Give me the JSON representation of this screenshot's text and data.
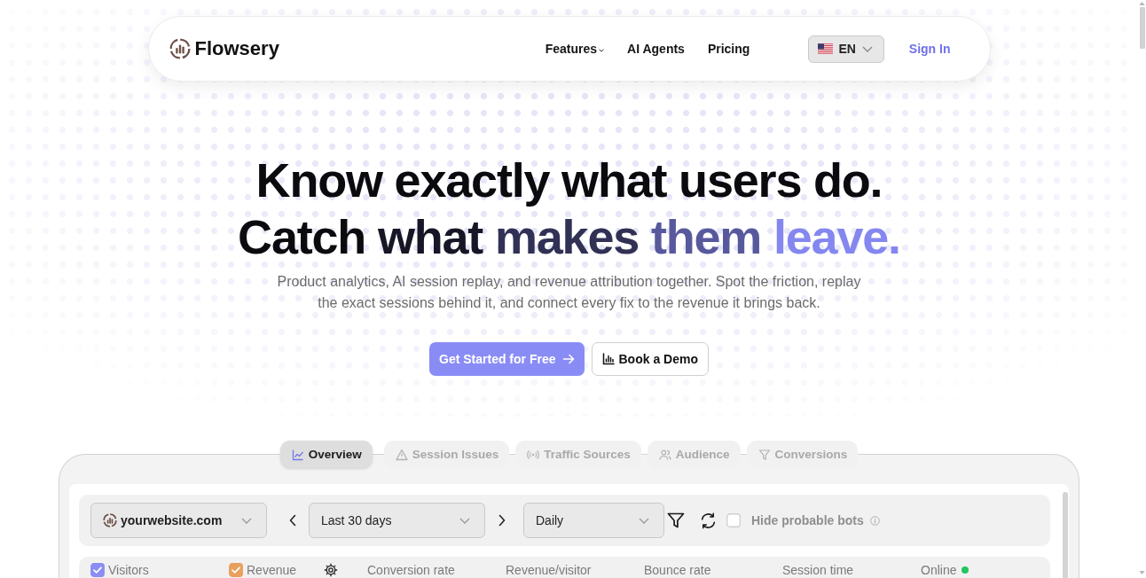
{
  "nav": {
    "brand": "Flowsery",
    "links": [
      {
        "label": "Features",
        "dropdown": true
      },
      {
        "label": "AI Agents",
        "dropdown": false
      },
      {
        "label": "Pricing",
        "dropdown": false
      }
    ],
    "language": "EN",
    "sign_in": "Sign In"
  },
  "hero": {
    "headline": [
      {
        "text": "Know exactly what users do.",
        "kind": "plain"
      },
      {
        "text": "Catch what makes them leave.",
        "kind": "gradient"
      }
    ],
    "subtitle": "Product analytics, AI session replay, and revenue attribution together. Spot the friction, replay the exact sessions behind it, and connect every fix to the revenue it brings back.",
    "buttons": [
      {
        "label": "Get Started for Free",
        "kind": "primary"
      },
      {
        "label": "Book a Demo",
        "kind": "secondary"
      }
    ]
  },
  "dashboard": {
    "tabs": [
      {
        "label": "Overview",
        "selected": true
      },
      {
        "label": "Session Issues",
        "selected": false
      },
      {
        "label": "Traffic Sources",
        "selected": false
      },
      {
        "label": "Audience",
        "selected": false
      },
      {
        "label": "Conversions",
        "selected": false
      }
    ],
    "filters": {
      "site": "yourwebsite.com",
      "date_range": "Last 30 days",
      "interval": "Daily",
      "hide_bots": {
        "label": "Hide probable bots",
        "checked": false
      }
    },
    "series_toggles": [
      {
        "label": "Visitors",
        "checked": true,
        "color": "#8b8df4"
      },
      {
        "label": "Revenue",
        "checked": true,
        "color": "#e8a05c"
      }
    ],
    "metrics": [
      "Conversion rate",
      "Revenue/visitor",
      "Bounce rate",
      "Session time"
    ],
    "online": {
      "label": "Online",
      "live": true
    }
  }
}
